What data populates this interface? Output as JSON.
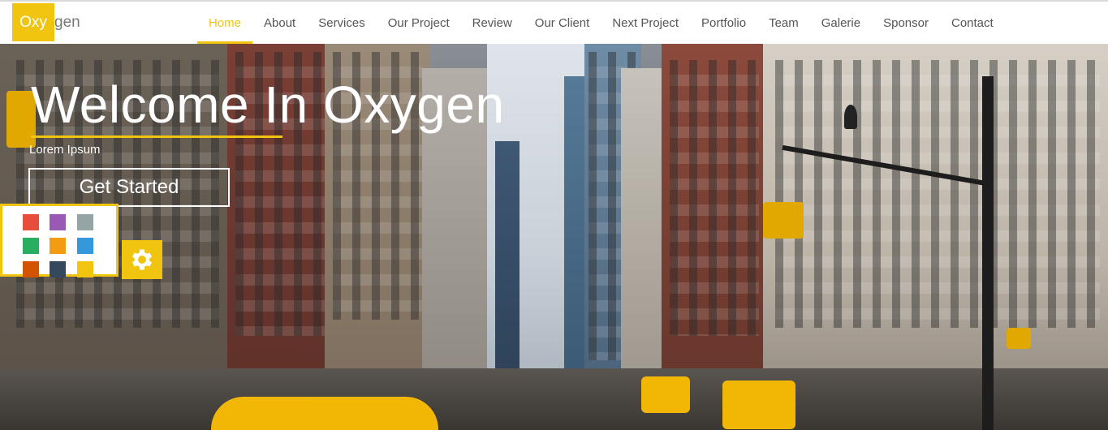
{
  "colors": {
    "accent": "#f1c40f",
    "nav_text": "#555555",
    "logo_rest": "#777777"
  },
  "logo": {
    "highlight": "Oxy",
    "rest": "gen"
  },
  "nav": {
    "items": [
      {
        "label": "Home",
        "active": true
      },
      {
        "label": "About",
        "active": false
      },
      {
        "label": "Services",
        "active": false
      },
      {
        "label": "Our Project",
        "active": false
      },
      {
        "label": "Review",
        "active": false
      },
      {
        "label": "Our Client",
        "active": false
      },
      {
        "label": "Next Project",
        "active": false
      },
      {
        "label": "Portfolio",
        "active": false
      },
      {
        "label": "Team",
        "active": false
      },
      {
        "label": "Galerie",
        "active": false
      },
      {
        "label": "Sponsor",
        "active": false
      },
      {
        "label": "Contact",
        "active": false
      }
    ]
  },
  "hero": {
    "title": "Welcome In Oxygen",
    "subtitle": "Lorem Ipsum",
    "cta_label": "Get Started",
    "background": "city-street-photo"
  },
  "style_switcher": {
    "icon": "gear-icon",
    "swatches": [
      "#e74c3c",
      "#9b59b6",
      "#95a5a6",
      "#27ae60",
      "#f39c12",
      "#3498db",
      "#d35400",
      "#34495e",
      "#f1c40f"
    ]
  }
}
